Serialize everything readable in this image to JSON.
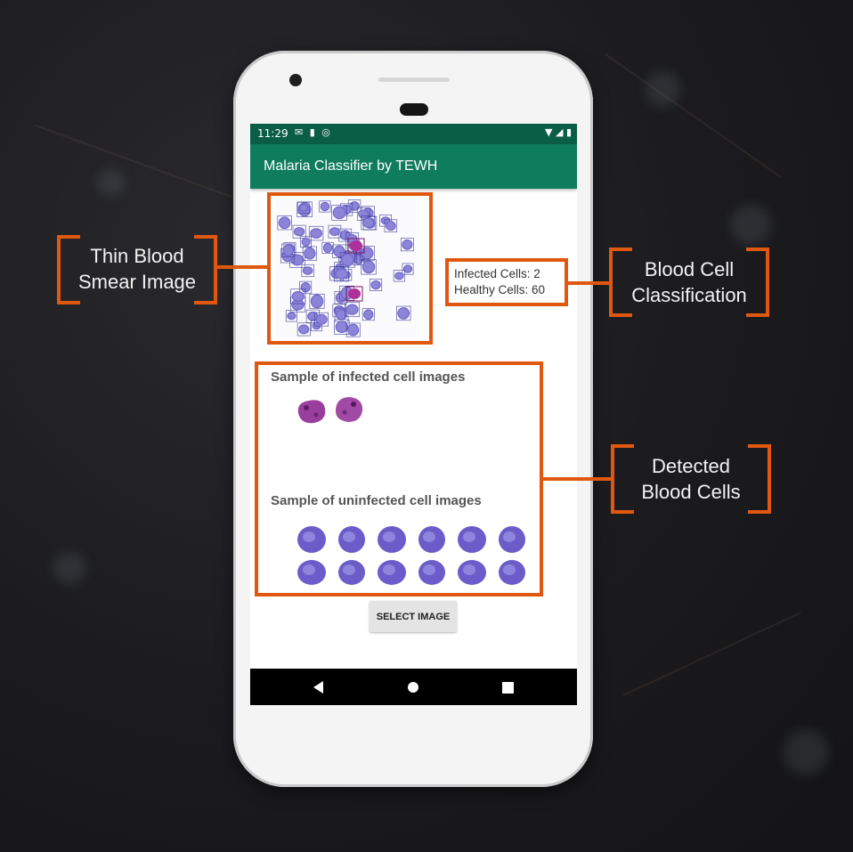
{
  "status_bar": {
    "time": "11:29",
    "left_icons": [
      "mail-icon",
      "sd-card-icon",
      "sync-icon"
    ],
    "right_icons": [
      "wifi-icon",
      "signal-icon",
      "battery-icon"
    ]
  },
  "app_bar": {
    "title": "Malaria Classifier by TEWH",
    "color": "#0f7c5e"
  },
  "results": {
    "infected": "Infected Cells: 2",
    "healthy": "Healthy Cells: 60"
  },
  "infected_section": {
    "heading": "Sample of infected cell images"
  },
  "uninfected_section": {
    "heading": "Sample of uninfected cell images"
  },
  "select_button": {
    "label": "SELECT IMAGE"
  },
  "nav_bar": {
    "buttons": [
      "back-icon",
      "home-icon",
      "recents-icon"
    ]
  },
  "callouts": {
    "smear": {
      "line1": "Thin Blood",
      "line2": "Smear Image"
    },
    "classification": {
      "line1": "Blood Cell",
      "line2": "Classification"
    },
    "detected": {
      "line1": "Detected",
      "line2": "Blood Cells"
    },
    "accent_color": "#e0580f"
  }
}
